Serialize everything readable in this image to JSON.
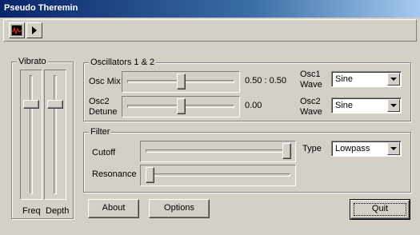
{
  "window": {
    "title": "Pseudo Theremin"
  },
  "toolbar": {
    "scope_icon": "oscilloscope-icon",
    "play_icon": "play-icon"
  },
  "vibrato": {
    "label": "Vibrato",
    "freq_label": "Freq",
    "depth_label": "Depth",
    "freq_level": 0.78,
    "depth_level": 0.78
  },
  "oscillators": {
    "label": "Oscillators 1 & 2",
    "mix_label": "Osc Mix",
    "mix_value": "0.50 : 0.50",
    "mix_level": 0.5,
    "detune_label_1": "Osc2",
    "detune_label_2": "Detune",
    "detune_value": "0.00",
    "detune_level": 0.5,
    "osc1_label_1": "Osc1",
    "osc1_label_2": "Wave",
    "osc1_wave": "Sine",
    "osc2_label_1": "Osc2",
    "osc2_label_2": "Wave",
    "osc2_wave": "Sine"
  },
  "filter": {
    "label": "Filter",
    "cutoff_label": "Cutoff",
    "cutoff_level": 1.0,
    "resonance_label": "Resonance",
    "resonance_level": 0.0,
    "type_label": "Type",
    "type_value": "Lowpass"
  },
  "buttons": {
    "about": "About",
    "options": "Options",
    "quit": "Quit"
  }
}
